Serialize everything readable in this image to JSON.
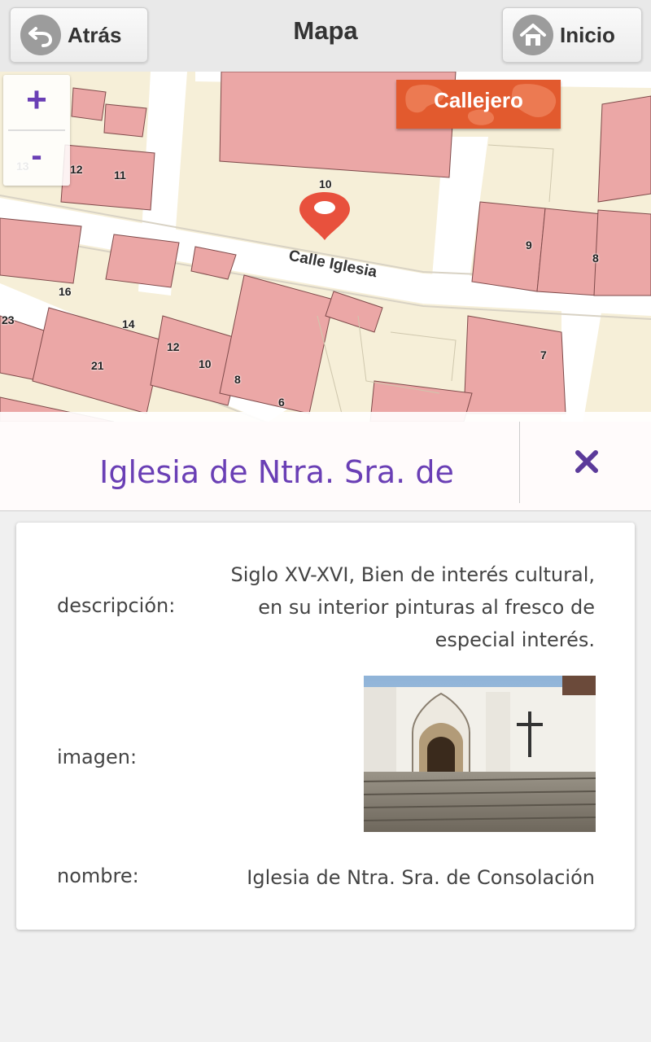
{
  "header": {
    "back_label": "Atrás",
    "title": "Mapa",
    "home_label": "Inicio"
  },
  "map": {
    "zoom_in": "+",
    "zoom_out": "-",
    "layer_button": "Callejero",
    "street_names": [
      "Calle Iglesia"
    ],
    "house_numbers": [
      "13",
      "12",
      "11",
      "10",
      "9",
      "8",
      "16",
      "23",
      "14",
      "12",
      "10",
      "8",
      "21",
      "6",
      "7"
    ],
    "colors": {
      "buildings": "#eba7a6",
      "blocks": "#f6efd8",
      "roads": "#ffffff",
      "accent": "#6a3fb5",
      "layer_button": "#e25a2e",
      "pin": "#e8513d"
    }
  },
  "infobar": {
    "place_name": "Iglesia de Ntra. Sra. de",
    "close_icon": "close-icon"
  },
  "details": {
    "descripcion_label": "descripción:",
    "descripcion_value": "Siglo XV-XVI, Bien de interés cultural, en su interior pinturas al fresco de especial interés.",
    "imagen_label": "imagen:",
    "nombre_label": "nombre:",
    "nombre_value": "Iglesia de Ntra. Sra. de Consolación"
  }
}
